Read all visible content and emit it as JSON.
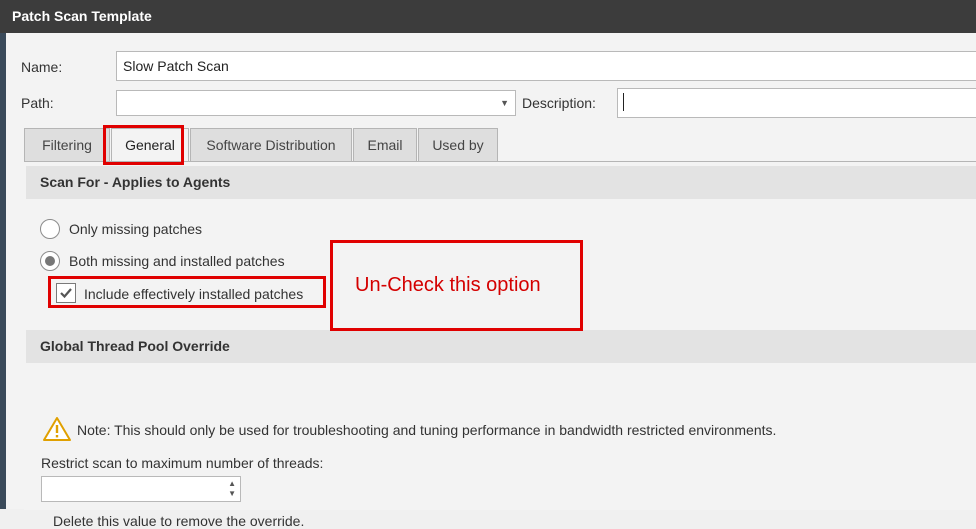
{
  "window": {
    "title": "Patch Scan Template"
  },
  "form": {
    "name_label": "Name:",
    "name_value": "Slow Patch Scan",
    "path_label": "Path:",
    "path_value": "",
    "description_label": "Description:",
    "description_value": ""
  },
  "tabs": [
    {
      "label": "Filtering"
    },
    {
      "label": "General"
    },
    {
      "label": "Software Distribution"
    },
    {
      "label": "Email"
    },
    {
      "label": "Used by"
    }
  ],
  "scan_for": {
    "header": "Scan For - Applies to Agents",
    "options": [
      {
        "label": "Only missing patches",
        "selected": false
      },
      {
        "label": "Both missing and installed patches",
        "selected": true
      }
    ],
    "include_label": "Include effectively installed patches",
    "include_checked": true
  },
  "annotation": {
    "text": "Un-Check this option",
    "color": "#e00000"
  },
  "thread_pool": {
    "header": "Global Thread Pool Override",
    "note": "Note: This should only be used for troubleshooting and tuning performance in bandwidth restricted environments.",
    "restrict_label": "Restrict scan to maximum number of threads:",
    "threads_value": "",
    "hint": "Delete this value to remove the override."
  }
}
